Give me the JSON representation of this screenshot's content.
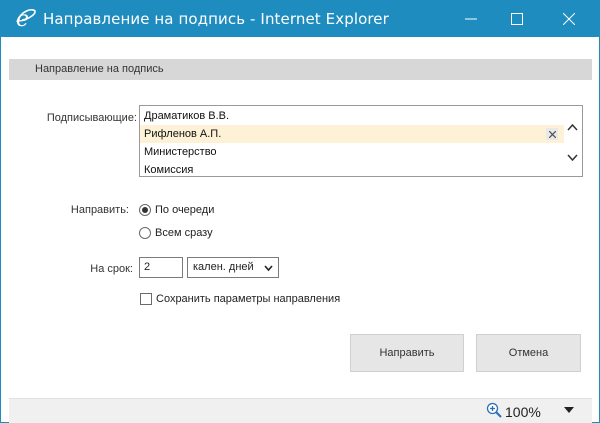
{
  "window": {
    "title": "Направление на подпись - Internet Explorer",
    "accent": "#1e8cbf"
  },
  "form": {
    "header": "Направление на подпись",
    "signers_label": "Подписывающие:",
    "signers": [
      {
        "name": "Драматиков В.В.",
        "selected": false
      },
      {
        "name": "Рифленов А.П.",
        "selected": true
      },
      {
        "name": "Министерство",
        "selected": false
      },
      {
        "name": "Комиссия",
        "selected": false
      }
    ],
    "direct_label": "Направить:",
    "options": [
      {
        "label": "По очереди",
        "checked": true
      },
      {
        "label": "Всем сразу",
        "checked": false
      }
    ],
    "term_label": "На срок:",
    "term_value": "2",
    "term_unit": "кален. дней",
    "save_params_label": "Сохранить параметры направления",
    "save_params_checked": false,
    "send_label": "Направить",
    "cancel_label": "Отмена"
  },
  "statusbar": {
    "zoom": "100%"
  }
}
